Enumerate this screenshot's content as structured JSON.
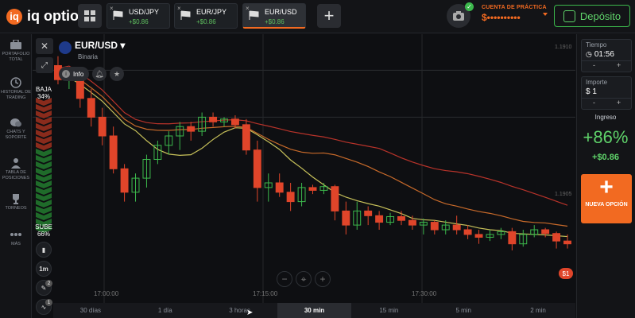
{
  "brand": {
    "logo_letter": "iq",
    "name": "iq option"
  },
  "tabs": [
    {
      "name": "USD/JPY",
      "gain": "+$0.86",
      "active": false
    },
    {
      "name": "EUR/JPY",
      "gain": "+$0.86",
      "active": false
    },
    {
      "name": "EUR/USD",
      "gain": "+$0.86",
      "active": true
    }
  ],
  "tab_close_glyph": "×",
  "add_tab_glyph": "+",
  "account": {
    "label": "CUENTA DE PRÁCTICA",
    "balance": "$••••••••••"
  },
  "deposit_label": "Depósito",
  "sidebar": [
    {
      "label": "PORTAFOLIO TOTAL",
      "icon": "briefcase-icon"
    },
    {
      "label": "HISTORIAL DE TRADING",
      "icon": "history-icon"
    },
    {
      "label": "CHATS Y SOPORTE",
      "icon": "chat-icon"
    },
    {
      "label": "TABLA DE POSICIONES",
      "icon": "leaderboard-icon"
    },
    {
      "label": "TORNEOS",
      "icon": "trophy-icon"
    },
    {
      "label": "MÁS",
      "icon": "more-icon"
    }
  ],
  "asset": {
    "name": "EUR/USD",
    "type": "Binaria"
  },
  "info_label": "Info",
  "sentiment": {
    "down_label": "BAJA",
    "down_pct": "34%",
    "up_label": "SUBE",
    "up_pct": "66%"
  },
  "chart_tools": {
    "timeframe": "1m",
    "draw_badge": "2",
    "indicator_badge": "1"
  },
  "price_labels": [
    "1.1910",
    "1.1905"
  ],
  "time_labels": [
    "17:00:00",
    "17:15:00",
    "17:30:00"
  ],
  "timeframes": [
    {
      "label": "30 días",
      "active": false
    },
    {
      "label": "1 día",
      "active": false
    },
    {
      "label": "3 horas",
      "active": false
    },
    {
      "label": "30 min",
      "active": true
    },
    {
      "label": "15 min",
      "active": false
    },
    {
      "label": "5 min",
      "active": false
    },
    {
      "label": "2 min",
      "active": false
    }
  ],
  "trade": {
    "time_label": "Tiempo",
    "time_value": "01:56",
    "amount_label": "Importe",
    "amount_value": "$ 1",
    "minus": "-",
    "plus": "+",
    "profit_label": "Ingreso",
    "profit_pct": "+86%",
    "profit_amount": "+$0.86",
    "new_option_plus": "+",
    "new_option_label": "NUEVA OPCIÓN"
  },
  "position_badge": "$1",
  "colors": {
    "accent": "#f26a21",
    "up": "#3cb84c",
    "down": "#e0452a",
    "profit": "#5fd36a"
  },
  "chart_data": {
    "type": "candlestick",
    "candles": [
      {
        "o": 1.19105,
        "h": 1.19115,
        "l": 1.19085,
        "c": 1.1909
      },
      {
        "o": 1.1909,
        "h": 1.191,
        "l": 1.1908,
        "c": 1.19095
      },
      {
        "o": 1.19095,
        "h": 1.191,
        "l": 1.1906,
        "c": 1.1907
      },
      {
        "o": 1.1907,
        "h": 1.1908,
        "l": 1.1904,
        "c": 1.1905
      },
      {
        "o": 1.1905,
        "h": 1.1906,
        "l": 1.1902,
        "c": 1.1903
      },
      {
        "o": 1.1903,
        "h": 1.1904,
        "l": 1.1899,
        "c": 1.18995
      },
      {
        "o": 1.18995,
        "h": 1.19,
        "l": 1.1896,
        "c": 1.1897
      },
      {
        "o": 1.1897,
        "h": 1.1899,
        "l": 1.1896,
        "c": 1.18985
      },
      {
        "o": 1.18985,
        "h": 1.1901,
        "l": 1.18975,
        "c": 1.19005
      },
      {
        "o": 1.19005,
        "h": 1.19025,
        "l": 1.19,
        "c": 1.1902
      },
      {
        "o": 1.1902,
        "h": 1.19035,
        "l": 1.1901,
        "c": 1.1903
      },
      {
        "o": 1.1903,
        "h": 1.19045,
        "l": 1.19015,
        "c": 1.1904
      },
      {
        "o": 1.1904,
        "h": 1.19045,
        "l": 1.19025,
        "c": 1.19035
      },
      {
        "o": 1.19035,
        "h": 1.19055,
        "l": 1.1903,
        "c": 1.1905
      },
      {
        "o": 1.1905,
        "h": 1.19055,
        "l": 1.1904,
        "c": 1.19045
      },
      {
        "o": 1.19045,
        "h": 1.1905,
        "l": 1.1904,
        "c": 1.19048
      },
      {
        "o": 1.19048,
        "h": 1.19052,
        "l": 1.19038,
        "c": 1.19042
      },
      {
        "o": 1.19042,
        "h": 1.19048,
        "l": 1.1901,
        "c": 1.19015
      },
      {
        "o": 1.19015,
        "h": 1.19025,
        "l": 1.1896,
        "c": 1.18975
      },
      {
        "o": 1.18975,
        "h": 1.1899,
        "l": 1.1896,
        "c": 1.1898
      },
      {
        "o": 1.1898,
        "h": 1.1899,
        "l": 1.18965,
        "c": 1.1897
      },
      {
        "o": 1.1897,
        "h": 1.1898,
        "l": 1.1895,
        "c": 1.1896
      },
      {
        "o": 1.1896,
        "h": 1.1898,
        "l": 1.18955,
        "c": 1.18975
      },
      {
        "o": 1.18975,
        "h": 1.18978,
        "l": 1.18968,
        "c": 1.18972
      },
      {
        "o": 1.18972,
        "h": 1.1898,
        "l": 1.18968,
        "c": 1.18976
      },
      {
        "o": 1.18976,
        "h": 1.18978,
        "l": 1.1894,
        "c": 1.1895
      },
      {
        "o": 1.1895,
        "h": 1.1896,
        "l": 1.18925,
        "c": 1.18935
      },
      {
        "o": 1.18935,
        "h": 1.1896,
        "l": 1.1893,
        "c": 1.1895
      },
      {
        "o": 1.1895,
        "h": 1.18955,
        "l": 1.18935,
        "c": 1.18945
      },
      {
        "o": 1.18945,
        "h": 1.1895,
        "l": 1.1893,
        "c": 1.18938
      },
      {
        "o": 1.18938,
        "h": 1.18948,
        "l": 1.18935,
        "c": 1.18944
      },
      {
        "o": 1.18944,
        "h": 1.1895,
        "l": 1.18935,
        "c": 1.1894
      },
      {
        "o": 1.1894,
        "h": 1.18945,
        "l": 1.1893,
        "c": 1.18935
      },
      {
        "o": 1.18935,
        "h": 1.18942,
        "l": 1.18925,
        "c": 1.18938
      },
      {
        "o": 1.18938,
        "h": 1.1894,
        "l": 1.18925,
        "c": 1.1893
      },
      {
        "o": 1.1893,
        "h": 1.1894,
        "l": 1.18925,
        "c": 1.18935
      },
      {
        "o": 1.18935,
        "h": 1.18945,
        "l": 1.18925,
        "c": 1.1893
      },
      {
        "o": 1.1893,
        "h": 1.18935,
        "l": 1.1892,
        "c": 1.18925
      },
      {
        "o": 1.18925,
        "h": 1.1893,
        "l": 1.18915,
        "c": 1.18922
      },
      {
        "o": 1.18922,
        "h": 1.1893,
        "l": 1.18918,
        "c": 1.18925
      },
      {
        "o": 1.18925,
        "h": 1.18932,
        "l": 1.1892,
        "c": 1.18928
      },
      {
        "o": 1.18928,
        "h": 1.18932,
        "l": 1.18908,
        "c": 1.18915
      },
      {
        "o": 1.18915,
        "h": 1.1893,
        "l": 1.18912,
        "c": 1.18925
      },
      {
        "o": 1.18925,
        "h": 1.18935,
        "l": 1.18922,
        "c": 1.1893
      },
      {
        "o": 1.1893,
        "h": 1.18932,
        "l": 1.18922,
        "c": 1.18926
      },
      {
        "o": 1.18926,
        "h": 1.18928,
        "l": 1.1891,
        "c": 1.18918
      },
      {
        "o": 1.18918,
        "h": 1.18925,
        "l": 1.1891,
        "c": 1.18915
      }
    ],
    "ylim": [
      1.1888,
      1.1913
    ],
    "y_ticks": [
      1.191,
      1.1905
    ]
  }
}
